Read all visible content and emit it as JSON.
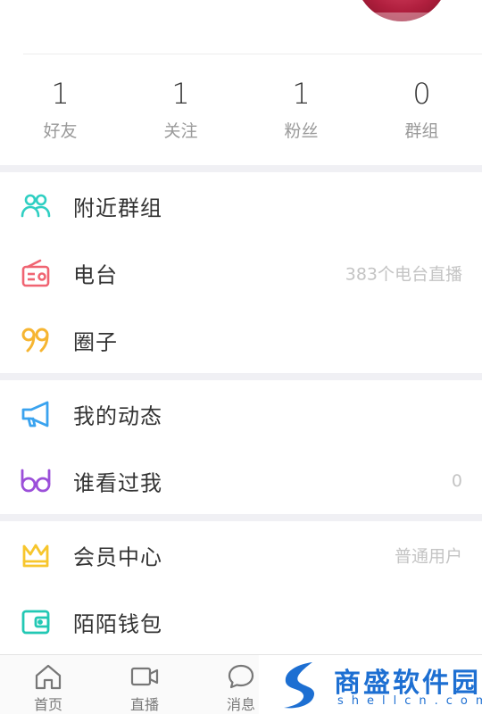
{
  "stats": [
    {
      "value": "1",
      "label": "好友"
    },
    {
      "value": "1",
      "label": "关注"
    },
    {
      "value": "1",
      "label": "粉丝"
    },
    {
      "value": "0",
      "label": "群组"
    }
  ],
  "menu": {
    "nearby_groups": {
      "label": "附近群组",
      "icon": "group-icon",
      "color": "#2fcfc2"
    },
    "radio": {
      "label": "电台",
      "right": "383个电台直播",
      "icon": "radio-icon",
      "color": "#f06472"
    },
    "circle": {
      "label": "圈子",
      "icon": "quote-icon",
      "color": "#f6b531"
    },
    "my_feed": {
      "label": "我的动态",
      "icon": "megaphone-icon",
      "color": "#3aa3ef"
    },
    "who_viewed": {
      "label": "谁看过我",
      "right": "0",
      "icon": "glasses-icon",
      "color": "#9b4fd9"
    },
    "vip": {
      "label": "会员中心",
      "right": "普通用户",
      "icon": "crown-icon",
      "color": "#f7c62d"
    },
    "wallet": {
      "label": "陌陌钱包",
      "icon": "wallet-icon",
      "color": "#22c8b4"
    }
  },
  "tabbar": [
    {
      "label": "首页",
      "icon": "home-icon"
    },
    {
      "label": "直播",
      "icon": "video-icon"
    },
    {
      "label": "消息",
      "icon": "chat-bubble-icon"
    }
  ],
  "watermark": {
    "title": "商盛软件园",
    "subtitle": "shellcn.com"
  }
}
